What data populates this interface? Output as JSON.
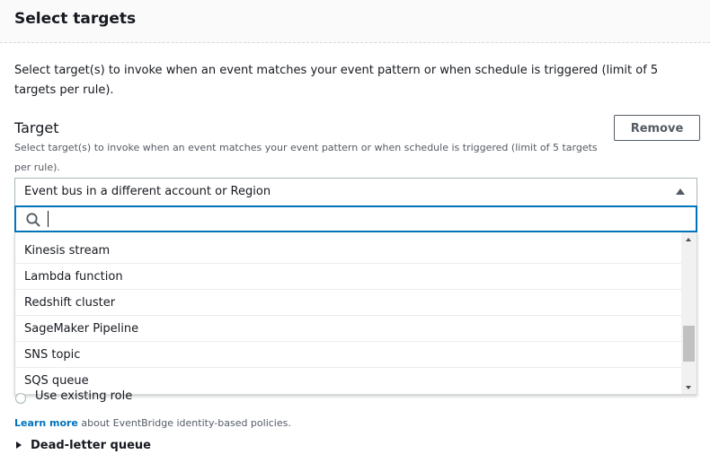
{
  "header": {
    "title": "Select targets"
  },
  "intro": {
    "text": "Select target(s) to invoke when an event matches your event pattern or when schedule is triggered (limit of 5 targets per rule)."
  },
  "target": {
    "title": "Target",
    "description": "Select target(s) to invoke when an event matches your event pattern or when schedule is triggered (limit of 5 targets per rule).",
    "remove_label": "Remove",
    "selected_value": "Event bus in a different account or Region",
    "search": {
      "value": "",
      "placeholder": ""
    },
    "options": [
      "Kinesis stream",
      "Lambda function",
      "Redshift cluster",
      "SageMaker Pipeline",
      "SNS topic",
      "SQS queue"
    ]
  },
  "role": {
    "use_existing_label": "Use existing role"
  },
  "footer": {
    "learn_more_link": "Learn more",
    "learn_more_rest": " about EventBridge identity-based policies.",
    "dead_letter_label": "Dead-letter queue"
  },
  "colors": {
    "accent": "#0073bb",
    "text": "#16191f",
    "muted": "#545b64"
  },
  "icons": {
    "search": "search-icon",
    "caret_up": "caret-up-icon",
    "caret_right": "caret-right-icon"
  }
}
